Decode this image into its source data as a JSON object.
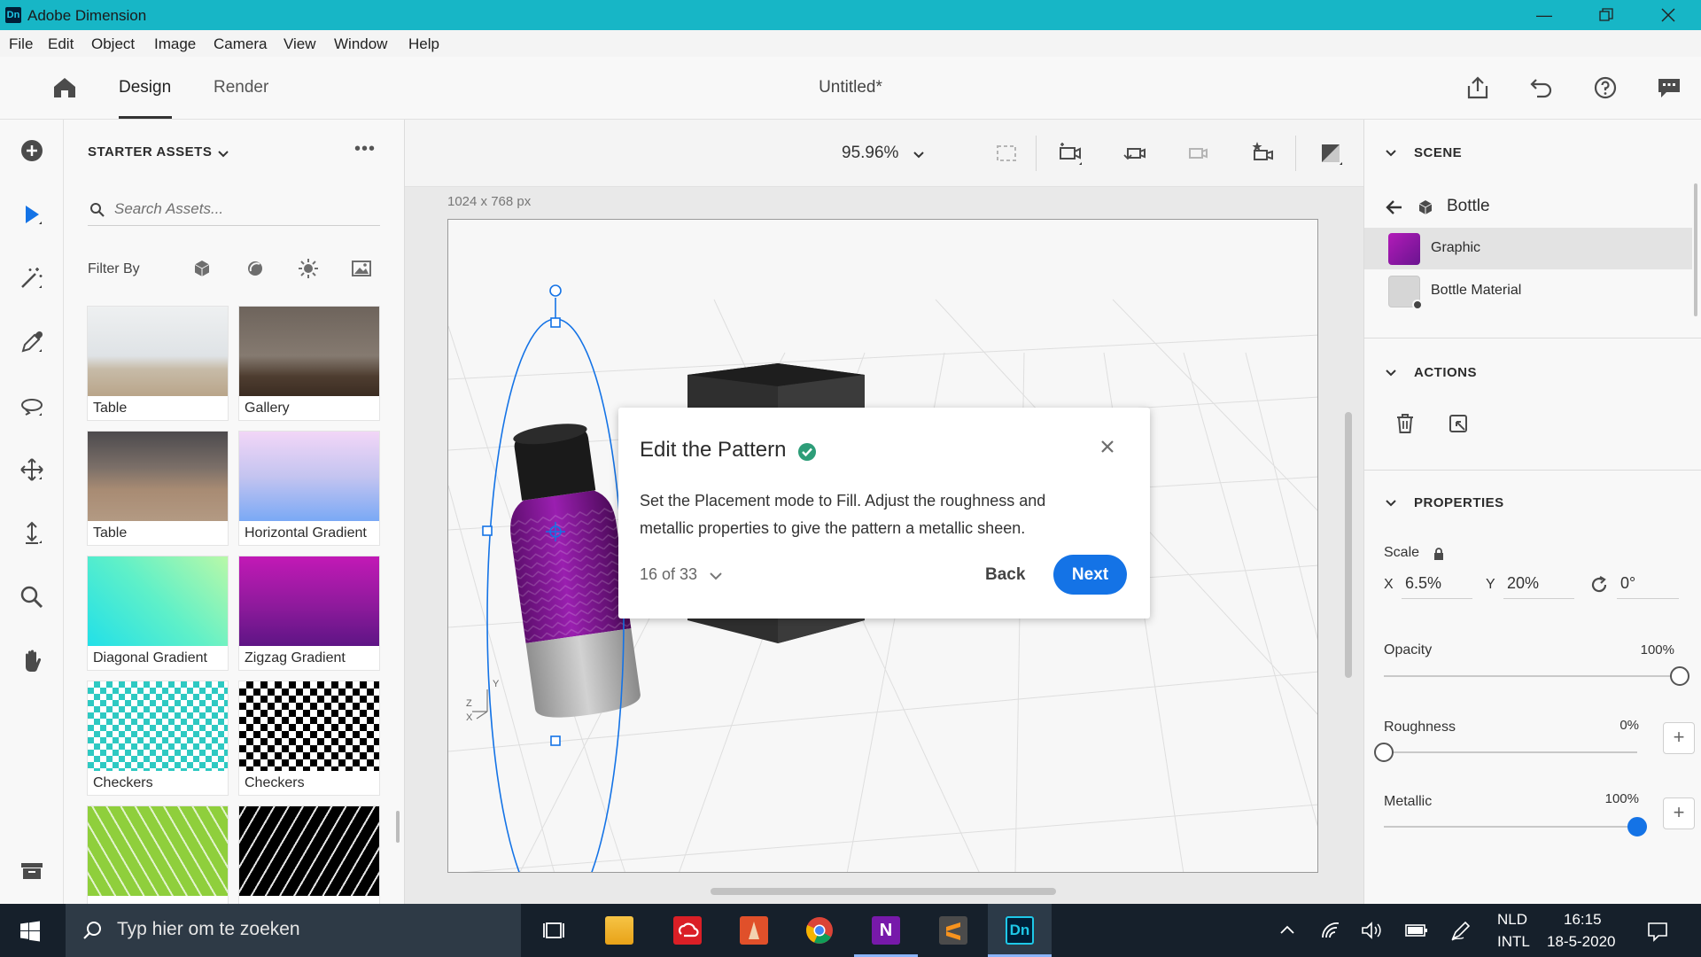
{
  "window": {
    "app_icon": "Dn",
    "title": "Adobe Dimension"
  },
  "menu": [
    "File",
    "Edit",
    "Object",
    "Image",
    "Camera",
    "View",
    "Window",
    "Help"
  ],
  "appbar": {
    "tabs": [
      "Design",
      "Render"
    ],
    "active_tab": "Design",
    "document_title": "Untitled*"
  },
  "assets": {
    "header": "STARTER ASSETS",
    "search_placeholder": "Search Assets...",
    "filter_label": "Filter By",
    "items": [
      {
        "label": "Table"
      },
      {
        "label": "Gallery"
      },
      {
        "label": "Table"
      },
      {
        "label": "Horizontal Gradient"
      },
      {
        "label": "Diagonal Gradient"
      },
      {
        "label": "Zigzag Gradient"
      },
      {
        "label": "Checkers"
      },
      {
        "label": "Checkers"
      },
      {
        "label": ""
      },
      {
        "label": ""
      }
    ]
  },
  "canvas": {
    "zoom": "95.96%",
    "dimensions": "1024 x 768 px",
    "axis_labels": {
      "y": "Y",
      "z": "Z",
      "x": "X"
    }
  },
  "dialog": {
    "title": "Edit the Pattern",
    "body": "Set the Placement mode to Fill. Adjust the roughness and metallic properties to give the pattern a metallic sheen.",
    "step": "16 of 33",
    "back_label": "Back",
    "next_label": "Next"
  },
  "scene": {
    "header": "SCENE",
    "object": "Bottle",
    "items": [
      {
        "label": "Graphic",
        "selected": true
      },
      {
        "label": "Bottle Material",
        "selected": false
      }
    ]
  },
  "actions": {
    "header": "ACTIONS"
  },
  "properties": {
    "header": "PROPERTIES",
    "scale_label": "Scale",
    "x_label": "X",
    "x_value": "6.5%",
    "y_label": "Y",
    "y_value": "20%",
    "rotation_value": "0°",
    "opacity": {
      "label": "Opacity",
      "value_text": "100%",
      "value": 1.0
    },
    "roughness": {
      "label": "Roughness",
      "value_text": "0%",
      "value": 0.0
    },
    "metallic": {
      "label": "Metallic",
      "value_text": "100%",
      "value": 1.0
    }
  },
  "taskbar": {
    "search_placeholder": "Typ hier om te zoeken",
    "language_top": "NLD",
    "language_bottom": "INTL",
    "time": "16:15",
    "date": "18-5-2020"
  },
  "colors": {
    "accent": "#1473e6",
    "titlebar": "#17b6c6",
    "graphic_purple": "#8a1a9a"
  }
}
